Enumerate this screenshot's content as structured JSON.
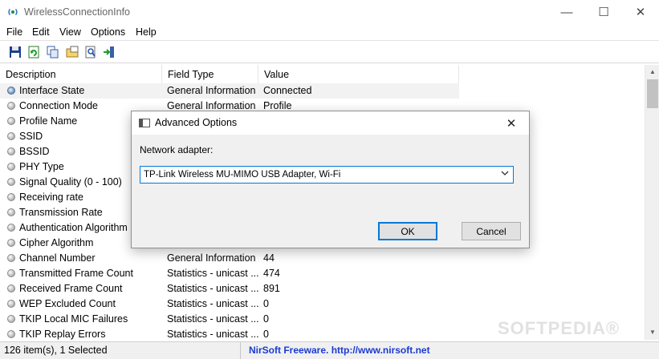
{
  "window": {
    "title": "WirelessConnectionInfo",
    "minimize": "—",
    "maximize": "☐",
    "close": "✕"
  },
  "menu": [
    "File",
    "Edit",
    "View",
    "Options",
    "Help"
  ],
  "toolbar": {
    "icons": [
      "save-icon",
      "refresh-icon",
      "copy-icon",
      "properties-icon",
      "find-icon",
      "exit-icon"
    ]
  },
  "columns": [
    "Description",
    "Field Type",
    "Value"
  ],
  "rows": [
    {
      "description": "Interface State",
      "field_type": "General Information",
      "value": "Connected"
    },
    {
      "description": "Connection Mode",
      "field_type": "General Information",
      "value": "Profile"
    },
    {
      "description": "Profile Name",
      "field_type": "",
      "value": ""
    },
    {
      "description": "SSID",
      "field_type": "",
      "value": ""
    },
    {
      "description": "BSSID",
      "field_type": "",
      "value": ""
    },
    {
      "description": "PHY Type",
      "field_type": "",
      "value": ""
    },
    {
      "description": "Signal Quality (0 - 100)",
      "field_type": "",
      "value": ""
    },
    {
      "description": "Receiving rate",
      "field_type": "",
      "value": ""
    },
    {
      "description": "Transmission Rate",
      "field_type": "",
      "value": ""
    },
    {
      "description": "Authentication Algorithm",
      "field_type": "",
      "value": ""
    },
    {
      "description": "Cipher Algorithm",
      "field_type": "",
      "value": ""
    },
    {
      "description": "Channel Number",
      "field_type": "General Information",
      "value": "44"
    },
    {
      "description": "Transmitted Frame Count",
      "field_type": "Statistics - unicast ...",
      "value": "474"
    },
    {
      "description": "Received Frame Count",
      "field_type": "Statistics - unicast ...",
      "value": "891"
    },
    {
      "description": "WEP Excluded Count",
      "field_type": "Statistics - unicast ...",
      "value": "0"
    },
    {
      "description": "TKIP Local MIC Failures",
      "field_type": "Statistics - unicast ...",
      "value": "0"
    },
    {
      "description": "TKIP Replay Errors",
      "field_type": "Statistics - unicast ...",
      "value": "0"
    }
  ],
  "status": {
    "items": "126 item(s), 1 Selected",
    "link": "NirSoft Freeware.  http://www.nirsoft.net"
  },
  "watermark": "SOFTPEDIA®",
  "dialog": {
    "title": "Advanced Options",
    "close": "✕",
    "label": "Network adapter:",
    "adapter_value": "TP-Link Wireless MU-MIMO USB Adapter, Wi-Fi",
    "ok_label": "OK",
    "cancel_label": "Cancel"
  }
}
